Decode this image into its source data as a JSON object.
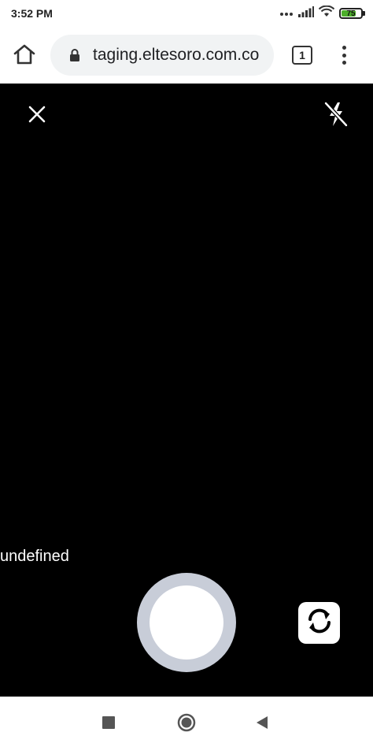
{
  "status_bar": {
    "time": "3:52 PM",
    "battery_level": "75",
    "battery_fraction": 0.75,
    "icons": [
      "more-dots-icon",
      "signal-icon",
      "wifi-icon",
      "battery-icon"
    ]
  },
  "browser": {
    "url": "taging.eltesoro.com.co",
    "tab_count": "1",
    "icons": [
      "home-icon",
      "lock-icon",
      "tabs-icon",
      "overflow-menu-icon"
    ]
  },
  "camera": {
    "label": "undefined",
    "icons": [
      "close-icon",
      "flash-off-icon",
      "shutter-button",
      "switch-camera-icon"
    ]
  },
  "nav_bar": {
    "icons": [
      "recents-square-icon",
      "home-circle-icon",
      "back-triangle-icon"
    ]
  },
  "colors": {
    "camera_background": "#000000",
    "shutter_ring": "#c8cdd8",
    "battery_fill": "#4caf2a",
    "url_bar": "#f1f3f4"
  }
}
